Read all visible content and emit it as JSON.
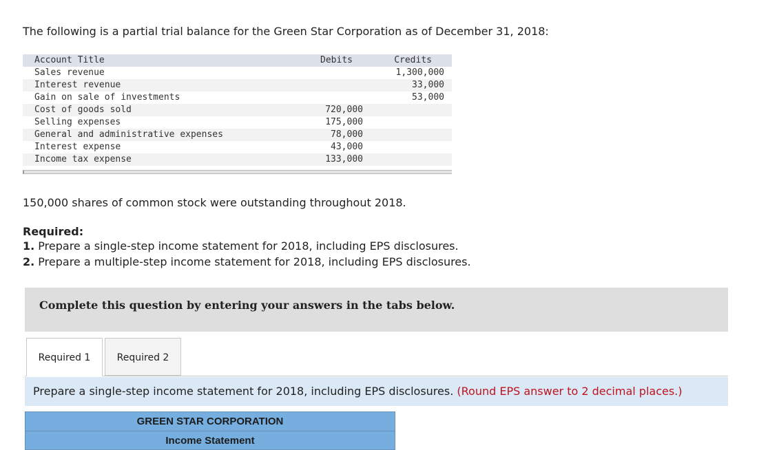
{
  "intro": "The following is a partial trial balance for the Green Star Corporation as of December 31, 2018:",
  "trial_balance": {
    "headers": {
      "title": "Account Title",
      "debits": "Debits",
      "credits": "Credits"
    },
    "rows": [
      {
        "title": "Sales revenue",
        "debit": "",
        "credit": "1,300,000"
      },
      {
        "title": "Interest revenue",
        "debit": "",
        "credit": "33,000"
      },
      {
        "title": "Gain on sale of investments",
        "debit": "",
        "credit": "53,000"
      },
      {
        "title": "Cost of goods sold",
        "debit": "720,000",
        "credit": ""
      },
      {
        "title": "Selling expenses",
        "debit": "175,000",
        "credit": ""
      },
      {
        "title": "General and administrative expenses",
        "debit": "78,000",
        "credit": ""
      },
      {
        "title": "Interest expense",
        "debit": "43,000",
        "credit": ""
      },
      {
        "title": "Income tax expense",
        "debit": "133,000",
        "credit": ""
      }
    ]
  },
  "shares_text": "150,000 shares of common stock were outstanding throughout 2018.",
  "required": {
    "heading": "Required:",
    "items": [
      {
        "num": "1.",
        "text": " Prepare a single-step income statement for 2018, including EPS disclosures."
      },
      {
        "num": "2.",
        "text": " Prepare a multiple-step income statement for 2018, including EPS disclosures."
      }
    ]
  },
  "banner": "Complete this question by entering your answers in the tabs below.",
  "tabs": [
    {
      "label": "Required 1",
      "active": true
    },
    {
      "label": "Required 2",
      "active": false
    }
  ],
  "instruction": {
    "text": "Prepare a single-step income statement for 2018, including EPS disclosures. ",
    "note": "(Round EPS answer to 2 decimal places.)"
  },
  "statement": {
    "company": "GREEN STAR CORPORATION",
    "title": "Income Statement"
  },
  "colors": {
    "header_row": "#dde1ea",
    "shade_row": "#f2f2f2",
    "banner_bg": "#dedede",
    "instruction_bg": "#dbe9f7",
    "note_red": "#c0121c",
    "statement_blue": "#77aee0"
  }
}
